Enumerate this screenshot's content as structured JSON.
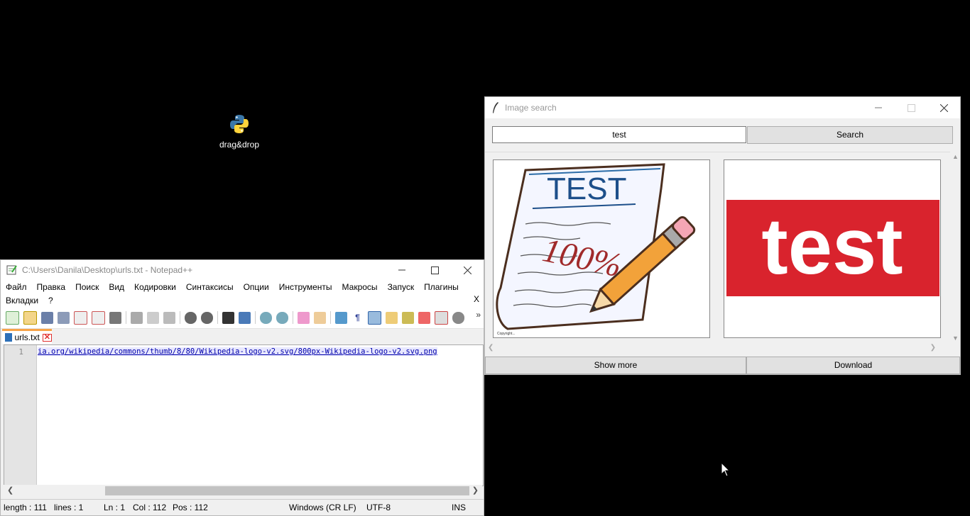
{
  "desktop": {
    "icon_label": "drag&drop",
    "icon_name": "python-icon"
  },
  "notepad": {
    "title": "C:\\Users\\Danila\\Desktop\\urls.txt - Notepad++",
    "menu_row1": [
      "Файл",
      "Правка",
      "Поиск",
      "Вид",
      "Кодировки",
      "Синтаксисы",
      "Опции",
      "Инструменты",
      "Макросы",
      "Запуск",
      "Плагины"
    ],
    "menu_row2": [
      "Вкладки",
      "?"
    ],
    "menu_close": "X",
    "toolbar_more": "»",
    "tab_label": "urls.txt",
    "line_number": "1",
    "line_text": "ia.org/wikipedia/commons/thumb/8/80/Wikipedia-logo-v2.svg/800px-Wikipedia-logo-v2.svg.png",
    "status": {
      "length": "length : 111",
      "lines": "lines : 1",
      "ln": "Ln : 1",
      "col": "Col : 112",
      "pos": "Pos : 112",
      "eol": "Windows (CR LF)",
      "encoding": "UTF-8",
      "mode": "INS"
    }
  },
  "image_search": {
    "title": "Image search",
    "search_value": "test",
    "search_button": "Search",
    "show_more_button": "Show more",
    "download_button": "Download",
    "results": [
      {
        "image_text": "TEST",
        "subtext": "100%"
      },
      {
        "image_text": "test"
      }
    ],
    "colors": {
      "test_banner": "#d9232d"
    }
  }
}
